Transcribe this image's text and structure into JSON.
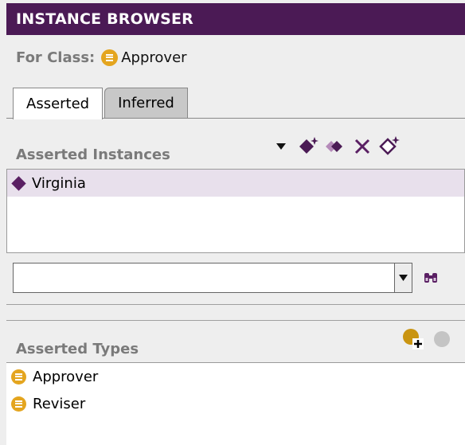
{
  "panel": {
    "title": "INSTANCE BROWSER"
  },
  "for_class": {
    "label": "For Class:",
    "value": "Approver",
    "icon": "class-icon",
    "icon_color": "#e4a51f"
  },
  "tabs": [
    {
      "label": "Asserted",
      "active": true
    },
    {
      "label": "Inferred",
      "active": false
    }
  ],
  "instances": {
    "label": "Asserted Instances",
    "toolbar": [
      "dropdown-arrow-icon",
      "create-instance-icon",
      "copy-instance-icon",
      "delete-instance-icon",
      "instance-more-icon"
    ],
    "items": [
      {
        "label": "Virginia",
        "selected": true
      }
    ]
  },
  "search": {
    "value": "",
    "icon": "binoculars-icon"
  },
  "types": {
    "label": "Asserted Types",
    "toolbar": [
      "add-type-icon",
      "remove-type-icon"
    ],
    "items": [
      {
        "label": "Approver",
        "icon": "class-icon"
      },
      {
        "label": "Reviser",
        "icon": "class-icon"
      }
    ]
  },
  "colors": {
    "title_bg": "#4b1a55",
    "instance_diamond": "#5a1f63",
    "class_icon": "#e4a51f",
    "selected_row": "#e8e0ec"
  }
}
